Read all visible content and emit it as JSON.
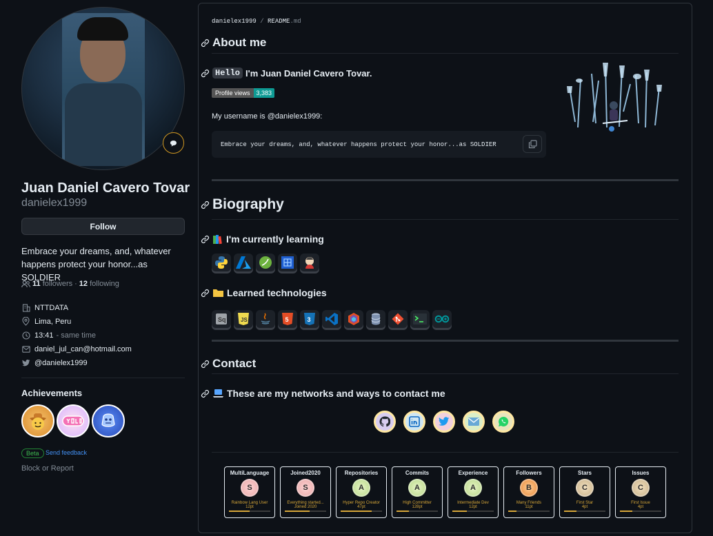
{
  "profile": {
    "name": "Juan Daniel Cavero Tovar",
    "login": "danielex1999",
    "follow_label": "Follow",
    "bio": "Embrace your dreams, and, whatever happens protect your honor...as SOLDIER",
    "followers_count": "11",
    "followers_label": "followers",
    "dot": "·",
    "following_count": "12",
    "following_label": "following",
    "company": "NTTDATA",
    "location": "Lima, Peru",
    "time": "13:41",
    "time_suffix": "- same time",
    "email": "daniel_jul_can@hotmail.com",
    "twitter": "@danielex1999"
  },
  "achievements": {
    "title": "Achievements",
    "badges": [
      "pull-shark-badge",
      "yolo-badge",
      "quickdraw-badge"
    ],
    "beta_label": "Beta",
    "feedback_label": "Send feedback",
    "block_label": "Block or Report"
  },
  "readme": {
    "owner": "danielex1999",
    "slash": "/",
    "file_base": "README",
    "file_ext": ".md",
    "about_heading": "About me",
    "hello_code": "Hello",
    "hello_text": "I'm Juan Daniel Cavero Tovar.",
    "profile_views_label": "Profile views",
    "profile_views_value": "3,383",
    "username_line": "My username is @danielex1999:",
    "quote": "Embrace your dreams, and, whatever happens protect your honor...as SOLDIER",
    "biography_heading": "Biography",
    "learning_heading": "I'm currently learning",
    "learning_icons": [
      "python-icon",
      "azure-icon",
      "spring-icon",
      "qiskit-icon",
      "jenkins-icon"
    ],
    "learned_heading": "Learned technologies",
    "learned_icons": [
      "sql-server-icon",
      "javascript-icon",
      "java-icon",
      "html5-icon",
      "css3-icon",
      "vscode-icon",
      "bootstrap-icon",
      "database-icon",
      "git-icon",
      "terminal-icon",
      "arduino-icon"
    ],
    "contact_heading": "Contact",
    "networks_heading": "These are my networks and ways to contact me",
    "contact_icons": [
      "github-icon",
      "linkedin-icon",
      "twitter-icon",
      "email-icon",
      "whatsapp-icon"
    ]
  },
  "trophies": [
    {
      "title": "MultiLanguage",
      "rank": "S",
      "subtitle": "Rainbow Lang User",
      "points": "12pt",
      "progress": 0.5
    },
    {
      "title": "Joined2020",
      "rank": "S",
      "subtitle": "Everything started...",
      "subtitle2": "Joined 2020",
      "points": "",
      "progress": 0.6
    },
    {
      "title": "Repositories",
      "rank": "A",
      "subtitle": "Hyper Repo Creator",
      "points": "47pt",
      "progress": 0.75
    },
    {
      "title": "Commits",
      "rank": "A",
      "subtitle": "High Committer",
      "points": "128pt",
      "progress": 0.3
    },
    {
      "title": "Experience",
      "rank": "A",
      "subtitle": "Intermediate Dev",
      "points": "12pt",
      "progress": 0.35
    },
    {
      "title": "Followers",
      "rank": "B",
      "subtitle": "Many Friends",
      "points": "11pt",
      "progress": 0.2
    },
    {
      "title": "Stars",
      "rank": "C",
      "subtitle": "First Star",
      "points": "4pt",
      "progress": 0.3
    },
    {
      "title": "Issues",
      "rank": "C",
      "subtitle": "First Issue",
      "points": "4pt",
      "progress": 0.3
    }
  ],
  "colors": {
    "background": "#0d1117",
    "accent_link": "#4493f8",
    "profile_views_badge": "#0e9b94",
    "trophy_gold": "#d7a739"
  }
}
